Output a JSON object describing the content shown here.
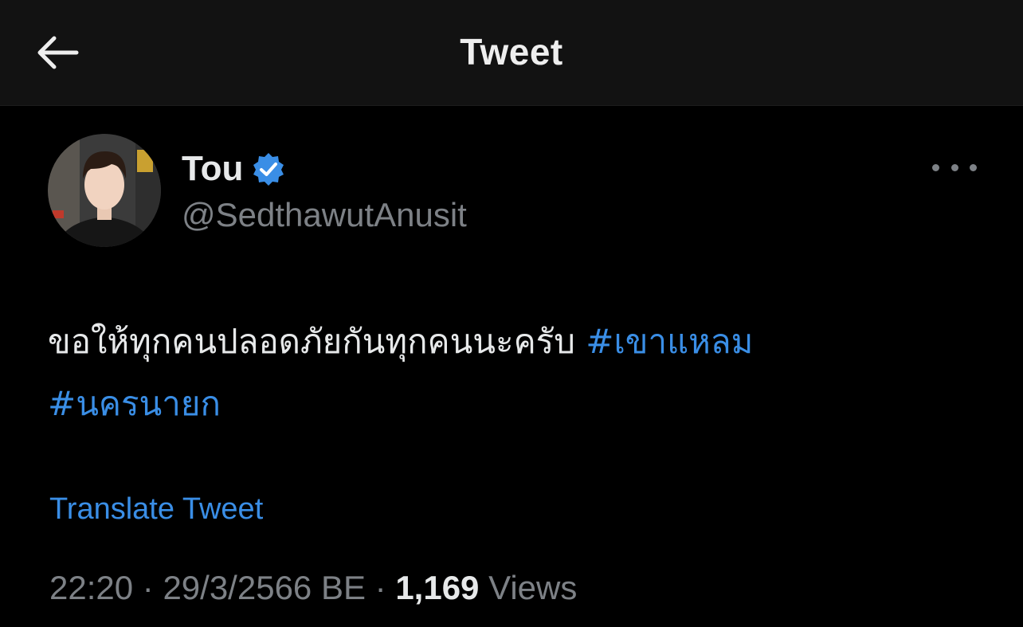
{
  "header": {
    "title": "Tweet",
    "back_icon": "arrow-left-icon"
  },
  "author": {
    "display_name": "Tou",
    "handle": "@SedthawutAnusit",
    "verified": true,
    "verified_color": "#3a8ee6"
  },
  "tweet": {
    "text": "ขอให้ทุกคนปลอดภัยกันทุกคนนะครับ",
    "hashtags": [
      "#เขาแหลม",
      "#นครนายก"
    ]
  },
  "translate_label": "Translate Tweet",
  "meta": {
    "time": "22:20",
    "separator": " · ",
    "date": "29/3/2566 BE",
    "views_count": "1,169",
    "views_label": "Views"
  },
  "colors": {
    "background": "#000000",
    "header_background": "#121212",
    "link": "#3a8ee6",
    "secondary_text": "#7d8186",
    "primary_text": "#e7e9ea"
  }
}
